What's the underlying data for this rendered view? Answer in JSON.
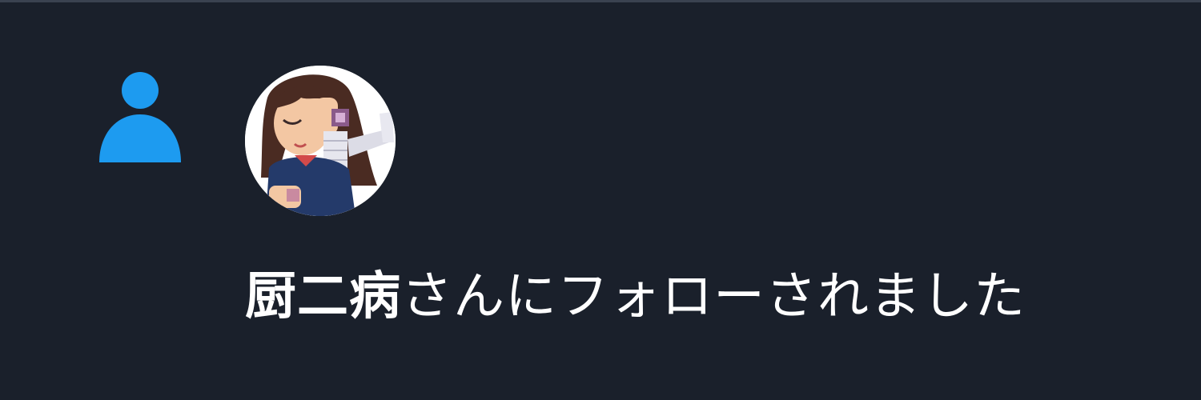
{
  "notification": {
    "type_icon": "person-icon",
    "accent_color": "#1d9bf0",
    "background_color": "#1a202b",
    "avatar_icon": "user-avatar-illustration",
    "user_name": "厨二病",
    "action_text": "さんにフォローされました"
  }
}
